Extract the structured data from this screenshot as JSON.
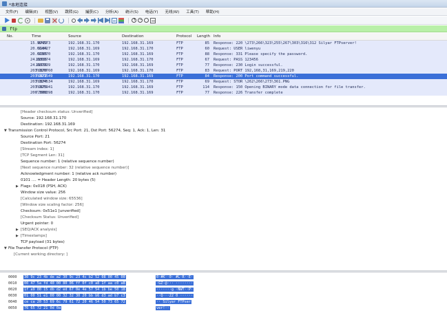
{
  "titlebar": {
    "title": "*本地连接"
  },
  "menu": [
    "文件(F)",
    "编辑(E)",
    "视图(V)",
    "跳转(G)",
    "捕获(C)",
    "分析(A)",
    "统计(S)",
    "电话(Y)",
    "无线(W)",
    "工具(T)",
    "帮助(H)"
  ],
  "filter": {
    "value": "ftp"
  },
  "packet_list": {
    "headers": {
      "no": "No.",
      "time": "Time",
      "source": "Source",
      "destination": "Destination",
      "protocol": "Protocol",
      "length": "Length",
      "info": "Info"
    },
    "rows": [
      {
        "no": "8719",
        "time": "15.994573",
        "source": "192.168.31.170",
        "destination": "192.168.31.169",
        "protocol": "FTP",
        "length": "85",
        "info": "Response: 220 \\273\\266\\323\\255\\267\\303\\316\\312 Silyar FTPserver!"
      },
      {
        "no": "9184",
        "time": "20.614427",
        "source": "192.168.31.169",
        "destination": "192.168.31.170",
        "protocol": "FTP",
        "length": "60",
        "info": "Request: USER liwenyu"
      },
      {
        "no": "9185",
        "time": "20.615070",
        "source": "192.168.31.170",
        "destination": "192.168.31.169",
        "protocol": "FTP",
        "length": "88",
        "info": "Response: 331 Please specify the password."
      },
      {
        "no": "11335",
        "time": "24.086974",
        "source": "192.168.31.169",
        "destination": "192.168.31.170",
        "protocol": "FTP",
        "length": "67",
        "info": "Request: PASS 123456"
      },
      {
        "no": "11336",
        "time": "24.087339",
        "source": "192.168.31.170",
        "destination": "192.168.31.169",
        "protocol": "FTP",
        "length": "77",
        "info": "Response: 230 Login successful."
      },
      {
        "no": "76870",
        "time": "203.320760",
        "source": "192.168.31.169",
        "destination": "192.168.31.170",
        "protocol": "FTP",
        "length": "83",
        "info": "Request: PORT 192,168,31,169,219,220"
      },
      {
        "no": "76871",
        "time": "203.321549",
        "source": "192.168.31.170",
        "destination": "192.168.31.169",
        "protocol": "FTP",
        "length": "84",
        "info": "Response: 200 Port command successful."
      },
      {
        "no": "76874",
        "time": "203.324534",
        "source": "192.168.31.169",
        "destination": "192.168.31.170",
        "protocol": "FTP",
        "length": "69",
        "info": "Request: STOR \\262\\266\\273\\361.PNG"
      },
      {
        "no": "76875",
        "time": "203.325941",
        "source": "192.168.31.170",
        "destination": "192.168.31.169",
        "protocol": "FTP",
        "length": "114",
        "info": "Response: 150 Opening BINARY mode data connection for file transfer."
      },
      {
        "no": "77008",
        "time": "206.396398",
        "source": "192.168.31.170",
        "destination": "192.168.31.169",
        "protocol": "FTP",
        "length": "77",
        "info": "Response: 226 Transfer complete"
      }
    ]
  },
  "details": {
    "lines": [
      "[Header checksum status: Unverified]",
      "Source: 192.168.31.170",
      "Destination: 192.168.31.169",
      "Transmission Control Protocol, Src Port: 21, Dst Port: 56274, Seq: 1, Ack: 1, Len: 31",
      "Source Port: 21",
      "Destination Port: 56274",
      "[Stream index: 1]",
      "[TCP Segment Len: 31]",
      "Sequence number: 1    (relative sequence number)",
      "[Next sequence number: 32    (relative sequence number)]",
      "Acknowledgment number: 1    (relative ack number)",
      "0101 .... = Header Length: 20 bytes (5)",
      "Flags: 0x018 (PSH, ACK)",
      "Window size value: 256",
      "[Calculated window size: 65536]",
      "[Window size scaling factor: 256]",
      "Checksum: 0x51e1 [unverified]",
      "[Checksum Status: Unverified]",
      "Urgent pointer: 0",
      "[SEQ/ACK analysis]",
      "[Timestamps]",
      "TCP payload (31 bytes)",
      "File Transfer Protocol (FTP)",
      "[Current working directory: ]"
    ]
  },
  "hex": {
    "rows": [
      {
        "offset": "0000",
        "bytes": "30 9c 23 4b de a2 30 9c  23 4c b2 52 08 00 45 00",
        "ascii": "0·#K··0· #L·R··E·"
      },
      {
        "offset": "0010",
        "bytes": "00 47 5a fd 40 00 80 06  ff 0f c0 a8 1f aa c0 a8",
        "ascii": "·GZ·@··· ········"
      },
      {
        "offset": "0020",
        "bytes": "1f a9 00 15 db d2 ed 67  0e 4e 57 54 1b be 50 18",
        "ascii": "·······g ·NWT··P·"
      },
      {
        "offset": "0030",
        "bytes": "01 00 51 e1 00 00 32 32  30 20 bb b6 d3 ad b7 c3",
        "ascii": "··Q···22 0 ······"
      },
      {
        "offset": "0040",
        "bytes": "ce ca 20 53 69 6c 79 61  72 20 46 54 50 73 65 72",
        "ascii": "·· Silyar FTPser"
      },
      {
        "offset": "0050",
        "bytes": "76 65 72 21 0d 0a",
        "ascii": "ver!··"
      }
    ]
  }
}
